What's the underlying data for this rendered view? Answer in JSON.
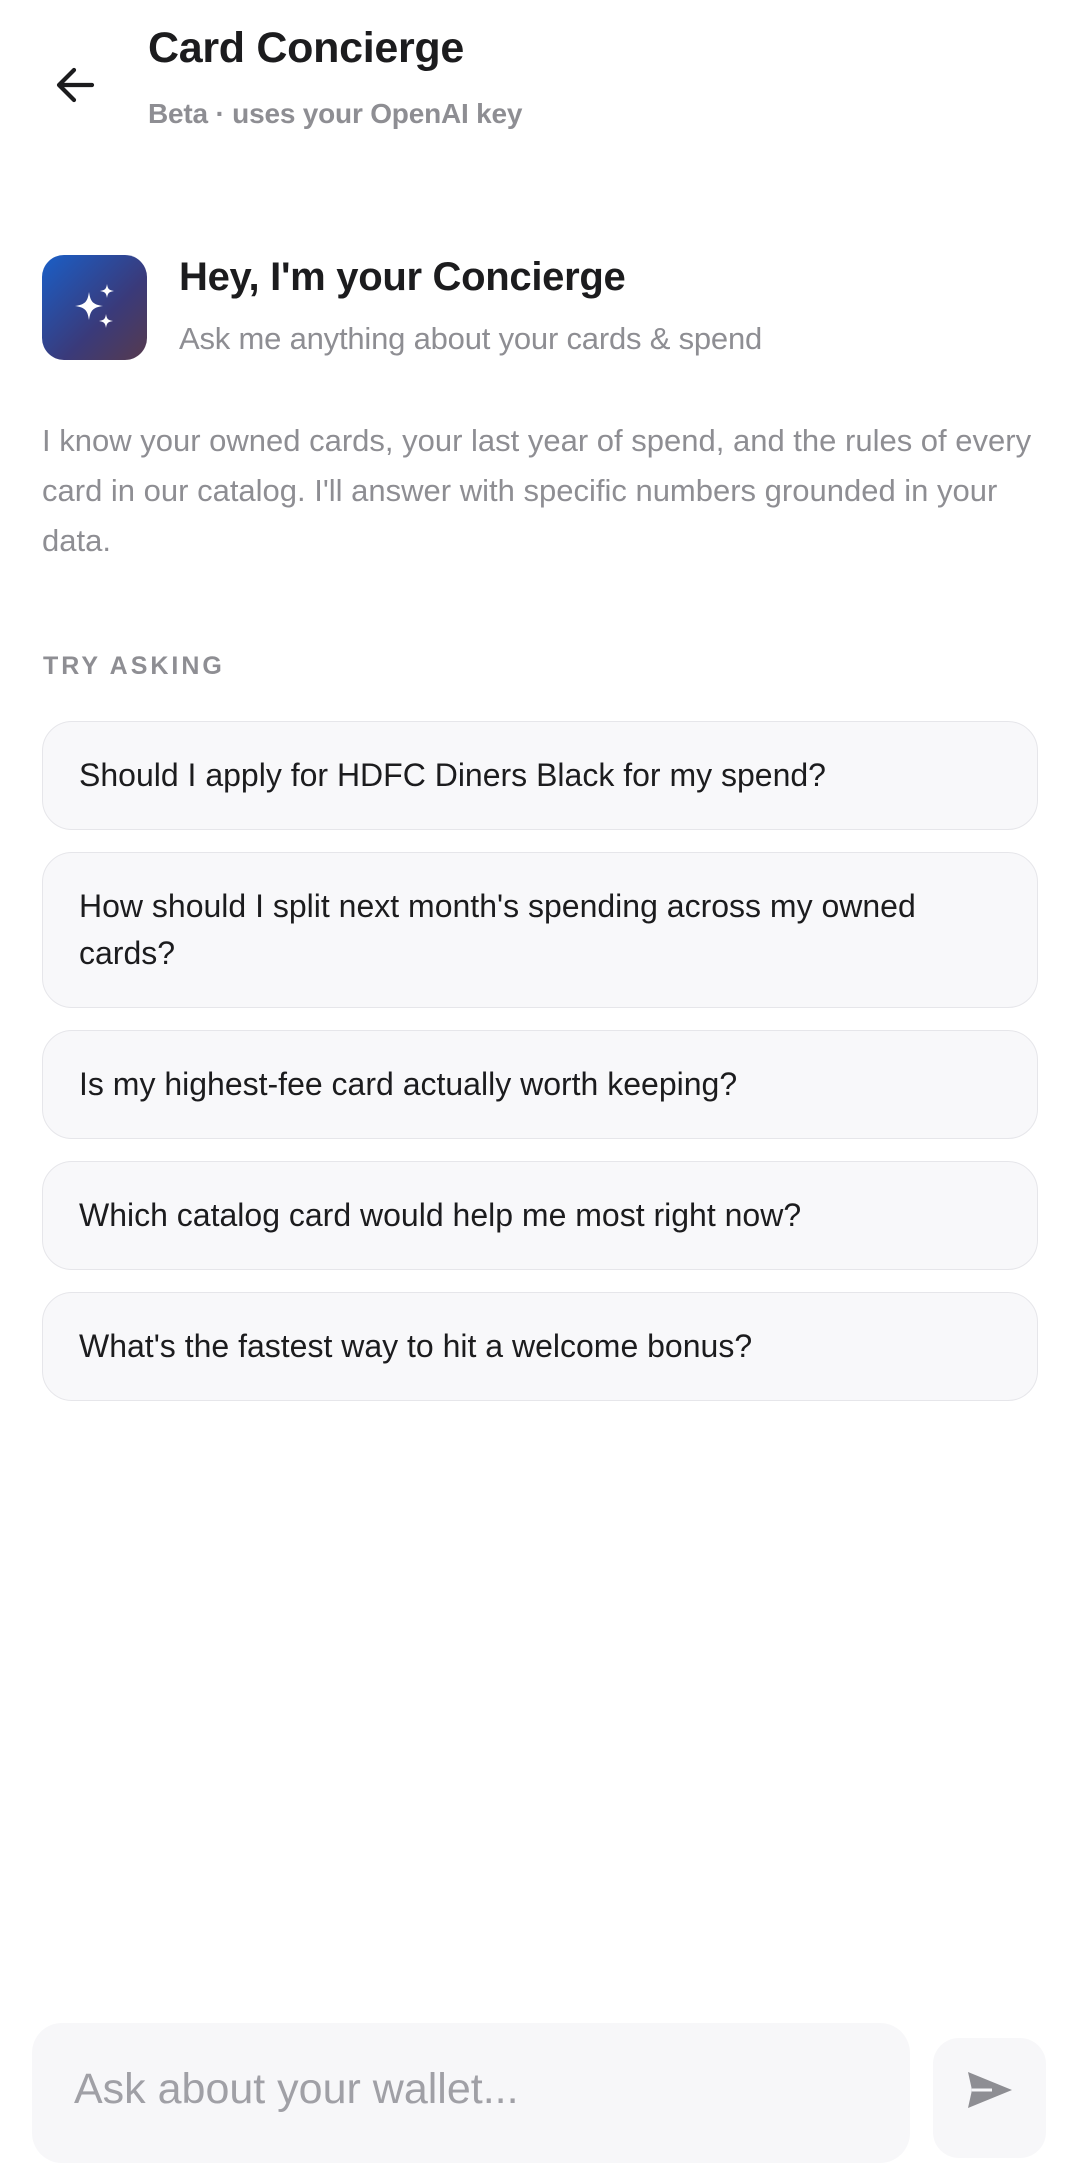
{
  "header": {
    "back_icon": "arrow-left-icon",
    "title": "Card Concierge",
    "subtitle": "Beta · uses your OpenAI key"
  },
  "intro": {
    "icon": "sparkles-icon",
    "title": "Hey, I'm your Concierge",
    "subtitle": "Ask me anything about your cards & spend"
  },
  "description": "I know your owned cards, your last year of spend, and the rules of every card in our catalog. I'll answer with specific numbers grounded in your data.",
  "suggestions": {
    "label": "TRY ASKING",
    "items": [
      "Should I apply for HDFC Diners Black for my spend?",
      "How should I split next month's spending across my owned cards?",
      "Is my highest-fee card actually worth keeping?",
      "Which catalog card would help me most right now?",
      "What's the fastest way to hit a welcome bonus?"
    ]
  },
  "composer": {
    "placeholder": "Ask about your wallet...",
    "value": "",
    "send_icon": "send-icon"
  },
  "colors": {
    "icon_gradient_start": "#1a5fc7",
    "icon_gradient_end": "#563a4e",
    "muted_text": "#8e8e93",
    "chip_background": "#f8f8fa"
  }
}
